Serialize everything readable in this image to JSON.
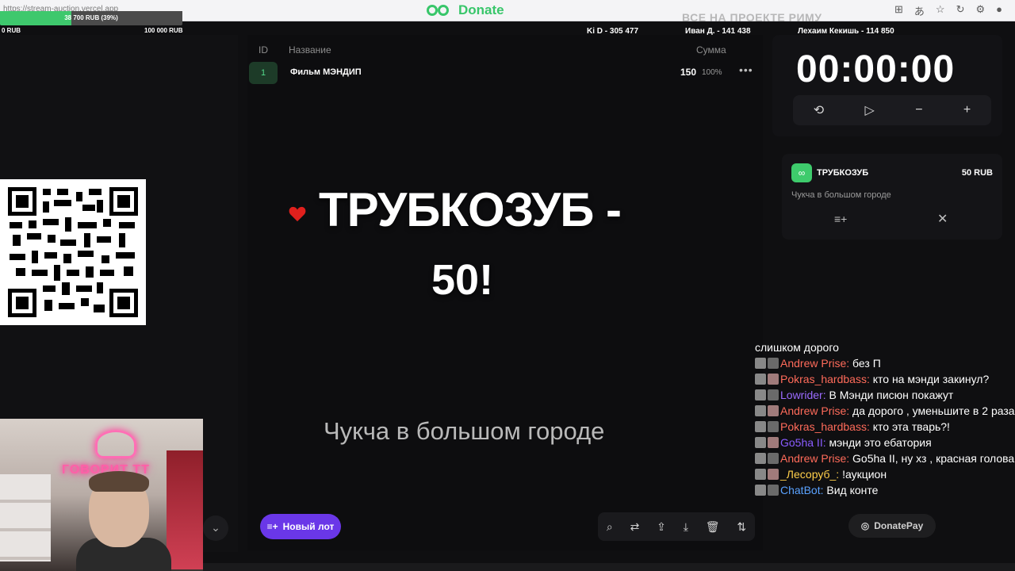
{
  "browser": {
    "url": "https://stream-auction.vercel.app",
    "brand": "Donate",
    "overlay_ghost_text": "ВСЕ НА ПРОЕКТЕ РИМУ"
  },
  "goal": {
    "progress_text": "38 700 RUB (39%)",
    "progress_percent": 39,
    "min_label": "0 RUB",
    "max_label": "100 000 RUB"
  },
  "leaderboard": [
    {
      "text": "Ki D - 305 477"
    },
    {
      "text": "Иван Д. - 141 438"
    },
    {
      "text": "Лехаим Кекишь - 114 850"
    }
  ],
  "table": {
    "col_id": "ID",
    "col_name": "Название",
    "col_sum": "Сумма",
    "rows": [
      {
        "id": "1",
        "name": "Фильм МЭНДИП",
        "sum": "150",
        "percent": "100%"
      }
    ]
  },
  "alert": {
    "title": "ТРУБКОЗУБ -",
    "amount": "50!",
    "message": "Чукча в большом городе"
  },
  "actions": {
    "new_lot": "Новый лот"
  },
  "timer": {
    "display": "00:00:00"
  },
  "donation": {
    "name": "ТРУБКОЗУБ",
    "amount": "50 RUB",
    "message": "Чукча в большом городе"
  },
  "chat": [
    {
      "user": "",
      "text": "слишком дорого",
      "color": "#ffffff"
    },
    {
      "user": "Andrew Prise:",
      "text": "без П",
      "color": "#ff6b5a"
    },
    {
      "user": "Pokras_hardbass:",
      "text": "кто на мэнди закинул?",
      "color": "#ff6b5a"
    },
    {
      "user": "Lowrider:",
      "text": "В Мэнди писюн покажут",
      "color": "#9b6bff"
    },
    {
      "user": "Andrew Prise:",
      "text": "да дорого , уменьшите в 2 раза",
      "color": "#ff6b5a"
    },
    {
      "user": "Pokras_hardbass:",
      "text": "кто эта тварь?!",
      "color": "#ff6b5a"
    },
    {
      "user": "Go5ha II:",
      "text": "мэнди это ебатория",
      "color": "#8a5cff"
    },
    {
      "user": "Andrew Prise:",
      "text": "Go5ha II, ну хз , красная голова",
      "color": "#ff6b5a"
    },
    {
      "user": "_Лесоруб_:",
      "text": "!аукцион",
      "color": "#ffcf4a"
    },
    {
      "user": "ChatBot:",
      "text": "Вид конте",
      "color": "#5aa2ff"
    }
  ],
  "donatepay": "DonatePay"
}
